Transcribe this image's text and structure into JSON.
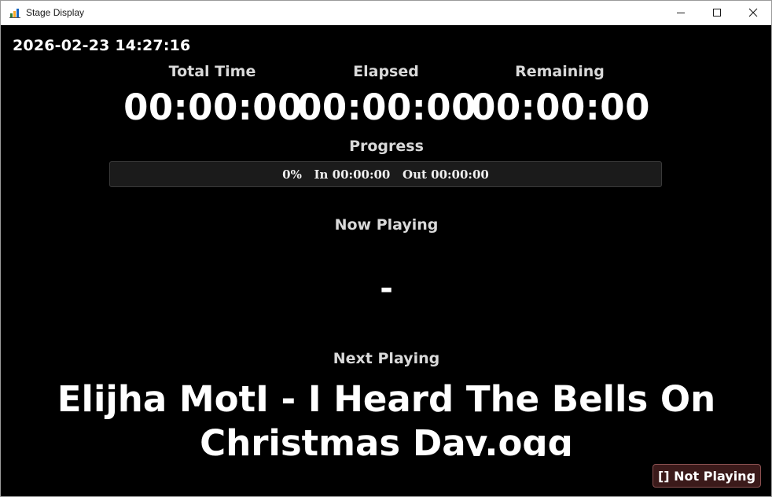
{
  "window": {
    "title": "Stage Display",
    "app_icon": "bar-chart-icon",
    "controls": [
      "minimize-icon",
      "maximize-icon",
      "close-icon"
    ]
  },
  "datetime": "2026-02-23 14:27:16",
  "stats": {
    "total_time": {
      "label": "Total Time",
      "value": "00:00:00"
    },
    "elapsed": {
      "label": "Elapsed",
      "value": "00:00:00"
    },
    "remaining": {
      "label": "Remaining",
      "value": "00:00:00"
    }
  },
  "progress": {
    "label": "Progress",
    "percent": 0,
    "text": "0%   In 00:00:00   Out 00:00:00"
  },
  "now_playing": {
    "label": "Now Playing",
    "value": "-"
  },
  "next_playing": {
    "label": "Next Playing",
    "value": "Elijha MotI - I Heard The Bells On Christmas Day.ogg"
  },
  "status": {
    "label": "[] Not Playing",
    "color": "#3b1a1a"
  },
  "colors": {
    "background": "#000000",
    "text": "#ffffff",
    "label": "#d9d9d9"
  }
}
